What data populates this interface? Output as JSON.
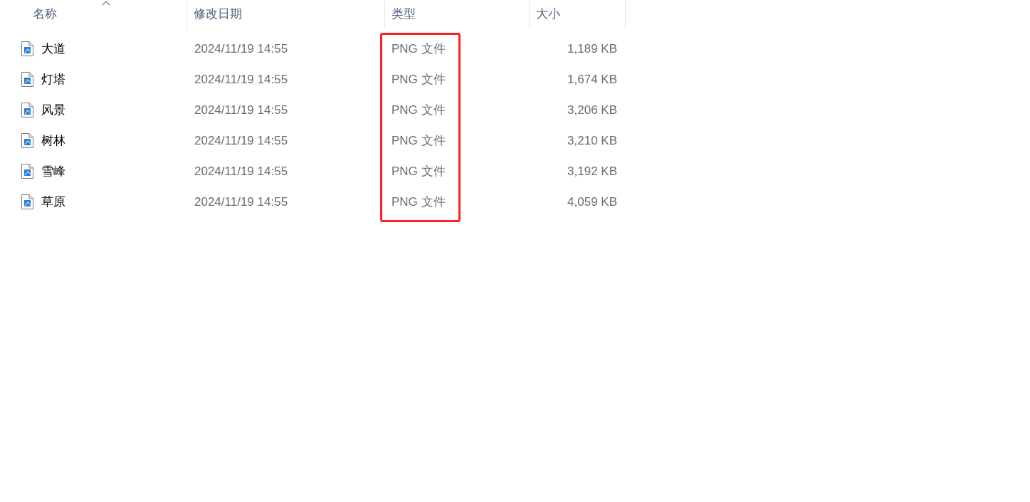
{
  "columns": [
    {
      "label": "名称",
      "sorted": true,
      "highlighted": false
    },
    {
      "label": "修改日期",
      "sorted": false,
      "highlighted": false
    },
    {
      "label": "类型",
      "sorted": false,
      "highlighted": true
    },
    {
      "label": "大小",
      "sorted": false,
      "highlighted": false
    }
  ],
  "rows": [
    {
      "name": "大道",
      "modified": "2024/11/19 14:55",
      "type": "PNG 文件",
      "size": "1,189 KB"
    },
    {
      "name": "灯塔",
      "modified": "2024/11/19 14:55",
      "type": "PNG 文件",
      "size": "1,674 KB"
    },
    {
      "name": "风景",
      "modified": "2024/11/19 14:55",
      "type": "PNG 文件",
      "size": "3,206 KB"
    },
    {
      "name": "树林",
      "modified": "2024/11/19 14:55",
      "type": "PNG 文件",
      "size": "3,210 KB"
    },
    {
      "name": "雪峰",
      "modified": "2024/11/19 14:55",
      "type": "PNG 文件",
      "size": "3,192 KB"
    },
    {
      "name": "草原",
      "modified": "2024/11/19 14:55",
      "type": "PNG 文件",
      "size": "4,059 KB"
    }
  ]
}
